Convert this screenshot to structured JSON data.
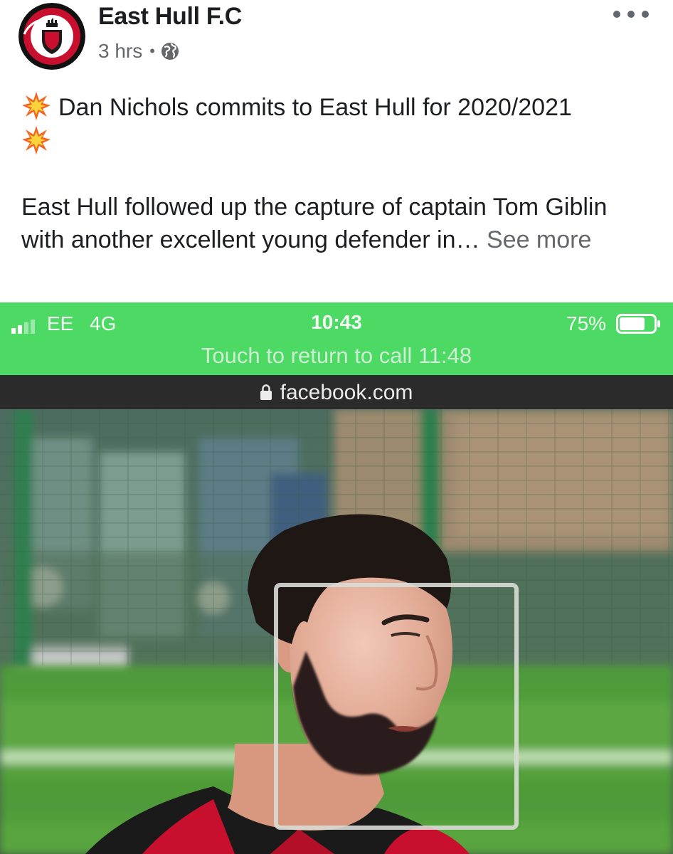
{
  "post": {
    "page_name": "East Hull F.C",
    "time": "3 hrs",
    "separator": "•",
    "privacy_icon": "globe-icon",
    "more_icon": "more-options-icon",
    "headline": "Dan Nichols commits to East Hull for 2020/2021",
    "headline_icon": "collision-burst-icon",
    "body": "East Hull followed up the capture of captain Tom Giblin with another excellent young defender in…",
    "see_more": "See more"
  },
  "screenshot": {
    "status_bar": {
      "carrier": "EE",
      "network": "4G",
      "time": "10:43",
      "battery": "75%",
      "battery_level": 0.75,
      "call_banner": "Touch to return to call 11:48",
      "banner_color": "#4cd964"
    },
    "browser": {
      "url": "facebook.com",
      "lock_icon": "lock-icon"
    }
  },
  "colors": {
    "text_primary": "#1c1e21",
    "text_secondary": "#65676b",
    "call_green": "#4cd964",
    "kit_red": "#c8102e"
  }
}
